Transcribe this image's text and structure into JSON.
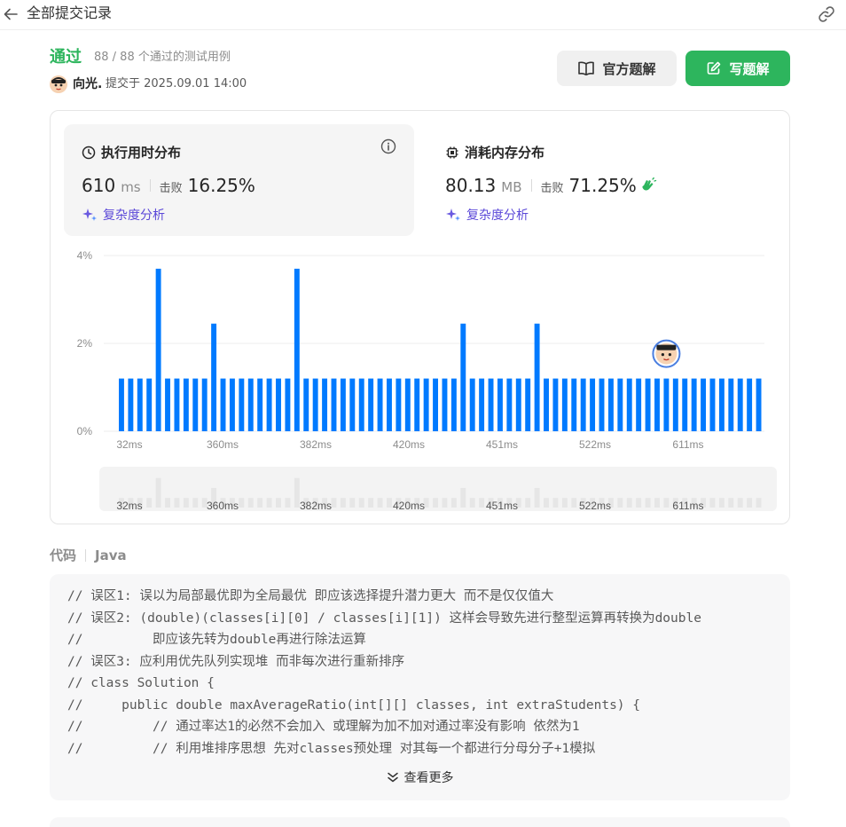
{
  "topbar": {
    "title": "全部提交记录"
  },
  "submission": {
    "status": "通过",
    "testcases": "88 / 88 个通过的测试用例",
    "username": "向光.",
    "submitted_at": "提交于 2025.09.01 14:00"
  },
  "actions": {
    "official_solution": "官方题解",
    "write_solution": "写题解"
  },
  "runtime": {
    "title": "执行用时分布",
    "value": "610",
    "unit": "ms",
    "beat_label": "击败",
    "beat_value": "16.25%",
    "complexity_label": "复杂度分析"
  },
  "memory": {
    "title": "消耗内存分布",
    "value": "80.13",
    "unit": "MB",
    "beat_label": "击败",
    "beat_value": "71.25%",
    "complexity_label": "复杂度分析"
  },
  "chart_data": {
    "type": "bar",
    "y_ticks": [
      "4%",
      "2%",
      "0%"
    ],
    "ylim": [
      0,
      4
    ],
    "x_tick_labels": [
      "32ms",
      "360ms",
      "382ms",
      "420ms",
      "451ms",
      "522ms",
      "611ms"
    ],
    "values": [
      1.2,
      1.2,
      1.2,
      1.2,
      3.7,
      1.2,
      1.2,
      1.2,
      1.2,
      1.2,
      2.45,
      1.2,
      1.2,
      1.2,
      1.2,
      1.2,
      1.2,
      1.2,
      1.2,
      3.7,
      1.2,
      1.2,
      1.2,
      1.2,
      1.2,
      1.2,
      1.2,
      1.2,
      1.2,
      1.2,
      1.2,
      1.2,
      1.2,
      1.2,
      1.2,
      1.2,
      1.2,
      2.45,
      1.2,
      1.2,
      1.2,
      1.2,
      1.2,
      1.2,
      1.2,
      2.45,
      1.2,
      1.2,
      1.2,
      1.2,
      1.2,
      1.2,
      1.2,
      1.2,
      1.2,
      1.2,
      1.2,
      1.2,
      1.2,
      1.2,
      1.2,
      1.2,
      1.2,
      1.2,
      1.2,
      1.2,
      1.2,
      1.2,
      1.2,
      1.2
    ],
    "user_marker_index": 59,
    "bar_color": "#007aff",
    "minimap_bar_color": "#e6e6e6"
  },
  "code": {
    "title": "代码",
    "language": "Java",
    "lines": [
      "// 误区1: 误以为局部最优即为全局最优 即应该选择提升潜力更大 而不是仅仅值大",
      "// 误区2: (double)(classes[i][0] / classes[i][1]) 这样会导致先进行整型运算再转换为double",
      "//         即应该先转为double再进行除法运算",
      "// 误区3: 应利用优先队列实现堆 而非每次进行重新排序",
      "// class Solution {",
      "//     public double maxAverageRatio(int[][] classes, int extraStudents) {",
      "//         // 通过率达1的必然不会加入 或理解为加不加对通过率没有影响 依然为1",
      "//         // 利用堆排序思想 先对classes预处理 对其每一个都进行分母分子+1模拟"
    ],
    "view_more": "查看更多"
  },
  "colors": {
    "accent_green": "#2db55d",
    "bar_blue": "#007aff",
    "complexity_purple": "#5b48d8"
  }
}
